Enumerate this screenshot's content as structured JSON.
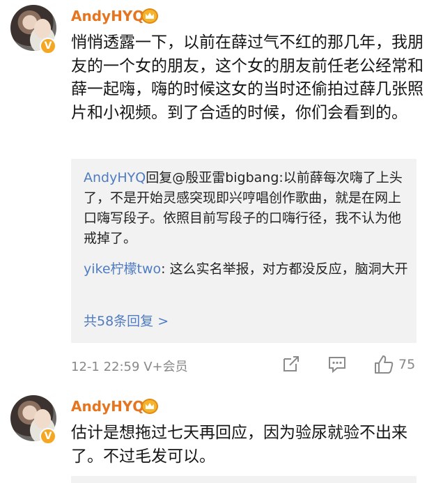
{
  "comment1": {
    "username": "AndyHYQ",
    "vip_badge": "V",
    "text": "悄悄透露一下，以前在薛过气不红的那几年，我朋友的一个女的朋友，这个女的朋友前任老公经常和薛一起嗨，嗨的时候这女的当时还偷拍过薛几张照片和小视频。到了合适的时候，你们会看到的。",
    "replies": [
      {
        "user": "AndyHYQ",
        "text": "回复@殷亚雷bigbang:以前薛每次嗨了上头了，不是开始灵感突现即兴哼唱创作歌曲，就是在网上口嗨写段子。依照目前写段子的口嗨行径，我不认为他戒掉了。"
      },
      {
        "user": "yike柠檬two",
        "text": ": 这么实名举报，对方都没反应，脑洞大开"
      }
    ],
    "more_replies": "共58条回复 >",
    "timestamp": "12-1 22:59",
    "vip_label": "V+会员",
    "like_count": "75"
  },
  "comment2": {
    "username": "AndyHYQ",
    "vip_badge": "V",
    "text": "估计是想拖过七天再回应，因为验尿就验不出来了。不过毛发可以。"
  },
  "colors": {
    "username": "#e5751f",
    "link": "#4f7cc0",
    "meta": "#888888",
    "reply_bg": "#f2f2f2",
    "badge": "#f5a623"
  },
  "icons": [
    "crown-icon",
    "v-badge-icon",
    "share-icon",
    "comment-icon",
    "like-icon"
  ]
}
